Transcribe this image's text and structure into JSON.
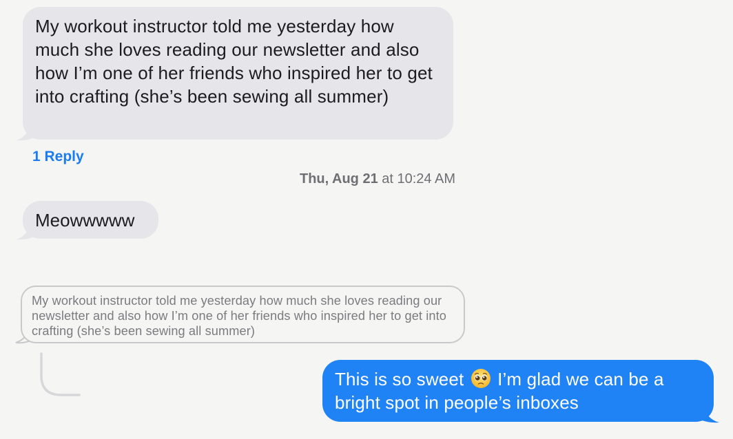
{
  "messages": {
    "first": {
      "text": "My workout instructor told me yesterday how much she loves reading our newsletter and also how I’m one of her friends who inspired her to get into crafting (she’s been sewing all summer)",
      "reply_link": "1 Reply"
    },
    "timestamp": {
      "day": "Thu, Aug 21",
      "time": "at 10:24 AM"
    },
    "second": {
      "text": "Meowwwww"
    },
    "quoted": {
      "text": "My workout instructor told me yesterday how much she loves reading our newsletter and also how I’m one of her friends who inspired her to get into crafting (she’s been sewing all summer)"
    },
    "reply": {
      "text_before_emoji": "This is so sweet",
      "emoji": "pleading-face-emoji",
      "text_after_emoji": "I’m glad we can be a bright spot in people’s inboxes"
    }
  },
  "colors": {
    "background": "#f5f5f4",
    "received_bubble": "#e5e5ea",
    "sent_bubble": "#1f82f5",
    "link": "#1a7cf0",
    "timestamp": "#6e6e73",
    "quoted_border": "#c9c9cc"
  }
}
